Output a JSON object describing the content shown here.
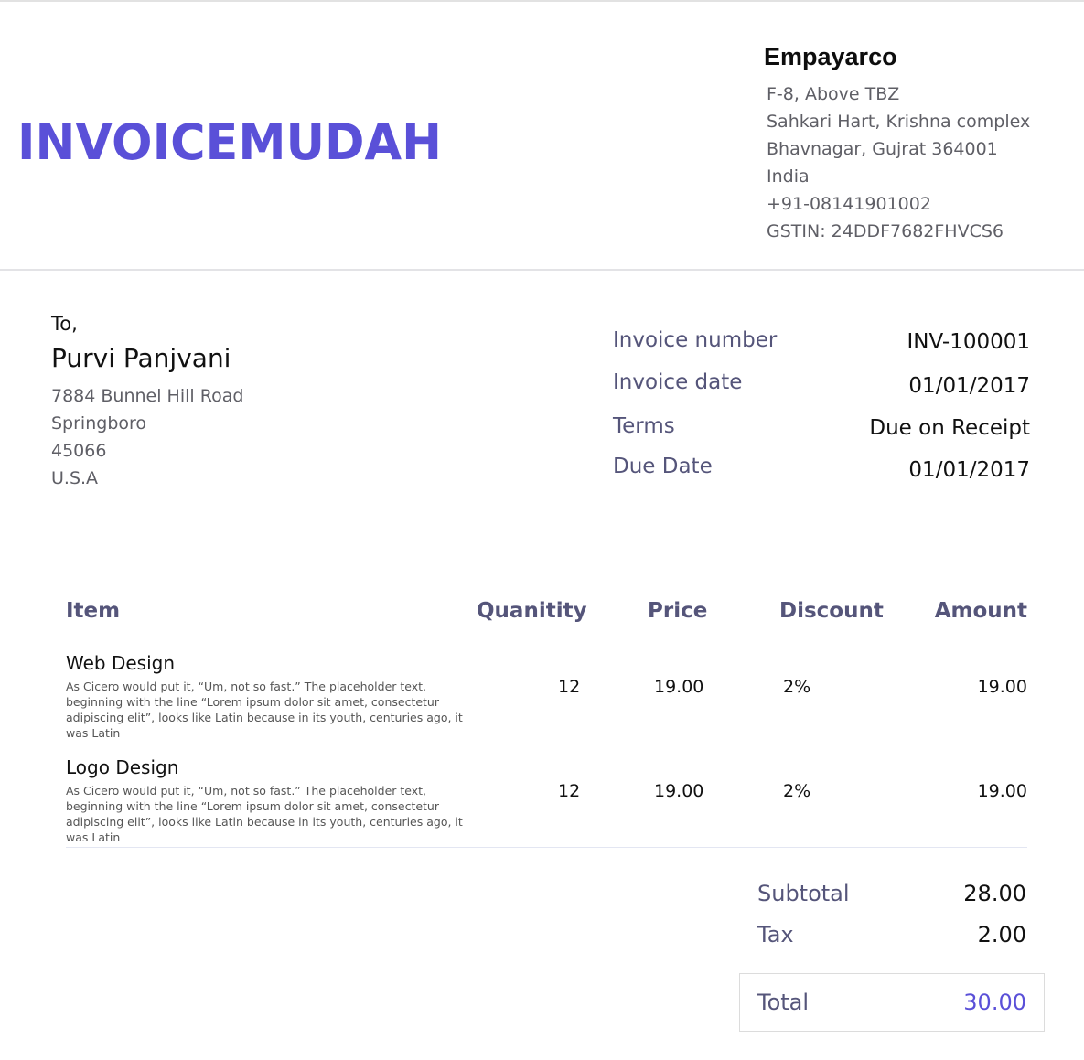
{
  "logo": {
    "text": "INVOICEMUDAH",
    "color": "#5a50d8"
  },
  "company": {
    "name": "Empayarco",
    "lines": [
      "F-8, Above TBZ",
      "Sahkari Hart, Krishna complex",
      "Bhavnagar, Gujrat 364001",
      "India",
      "+91-08141901002",
      "GSTIN: 24DDF7682FHVCS6"
    ]
  },
  "bill_to": {
    "label": "To,",
    "name": "Purvi Panjvani",
    "lines": [
      "7884 Bunnel Hill Road",
      "Springboro",
      "45066",
      "U.S.A"
    ]
  },
  "invoice_meta": [
    {
      "label": "Invoice number",
      "value": "INV-100001"
    },
    {
      "label": "Invoice date",
      "value": "01/01/2017"
    },
    {
      "label": "Terms",
      "value": "Due on Receipt"
    },
    {
      "label": "Due Date",
      "value": "01/01/2017"
    }
  ],
  "table": {
    "headers": {
      "item": "Item",
      "quantity": "Quanitity",
      "price": "Price",
      "discount": "Discount",
      "amount": "Amount"
    },
    "rows": [
      {
        "name": "Web Design",
        "description": "As Cicero would put it, “Um, not so fast.” The placeholder text, beginning with the line “Lorem ipsum dolor sit amet, consectetur adipiscing elit”, looks like Latin because in its youth, centuries ago, it was Latin",
        "quantity": "12",
        "price": "19.00",
        "discount": "2%",
        "amount": "19.00"
      },
      {
        "name": "Logo Design",
        "description": "As Cicero would put it, “Um, not so fast.” The placeholder text, beginning with the line “Lorem ipsum dolor sit amet, consectetur adipiscing elit”, looks like Latin because in its youth, centuries ago, it was Latin",
        "quantity": "12",
        "price": "19.00",
        "discount": "2%",
        "amount": "19.00"
      }
    ]
  },
  "totals": {
    "subtotal_label": "Subtotal",
    "subtotal_value": "28.00",
    "tax_label": "Tax",
    "tax_value": "2.00",
    "total_label": "Total",
    "total_value": "30.00"
  },
  "colors": {
    "accent": "#5a50d8",
    "label": "#55557a",
    "muted": "#5f5f66"
  }
}
